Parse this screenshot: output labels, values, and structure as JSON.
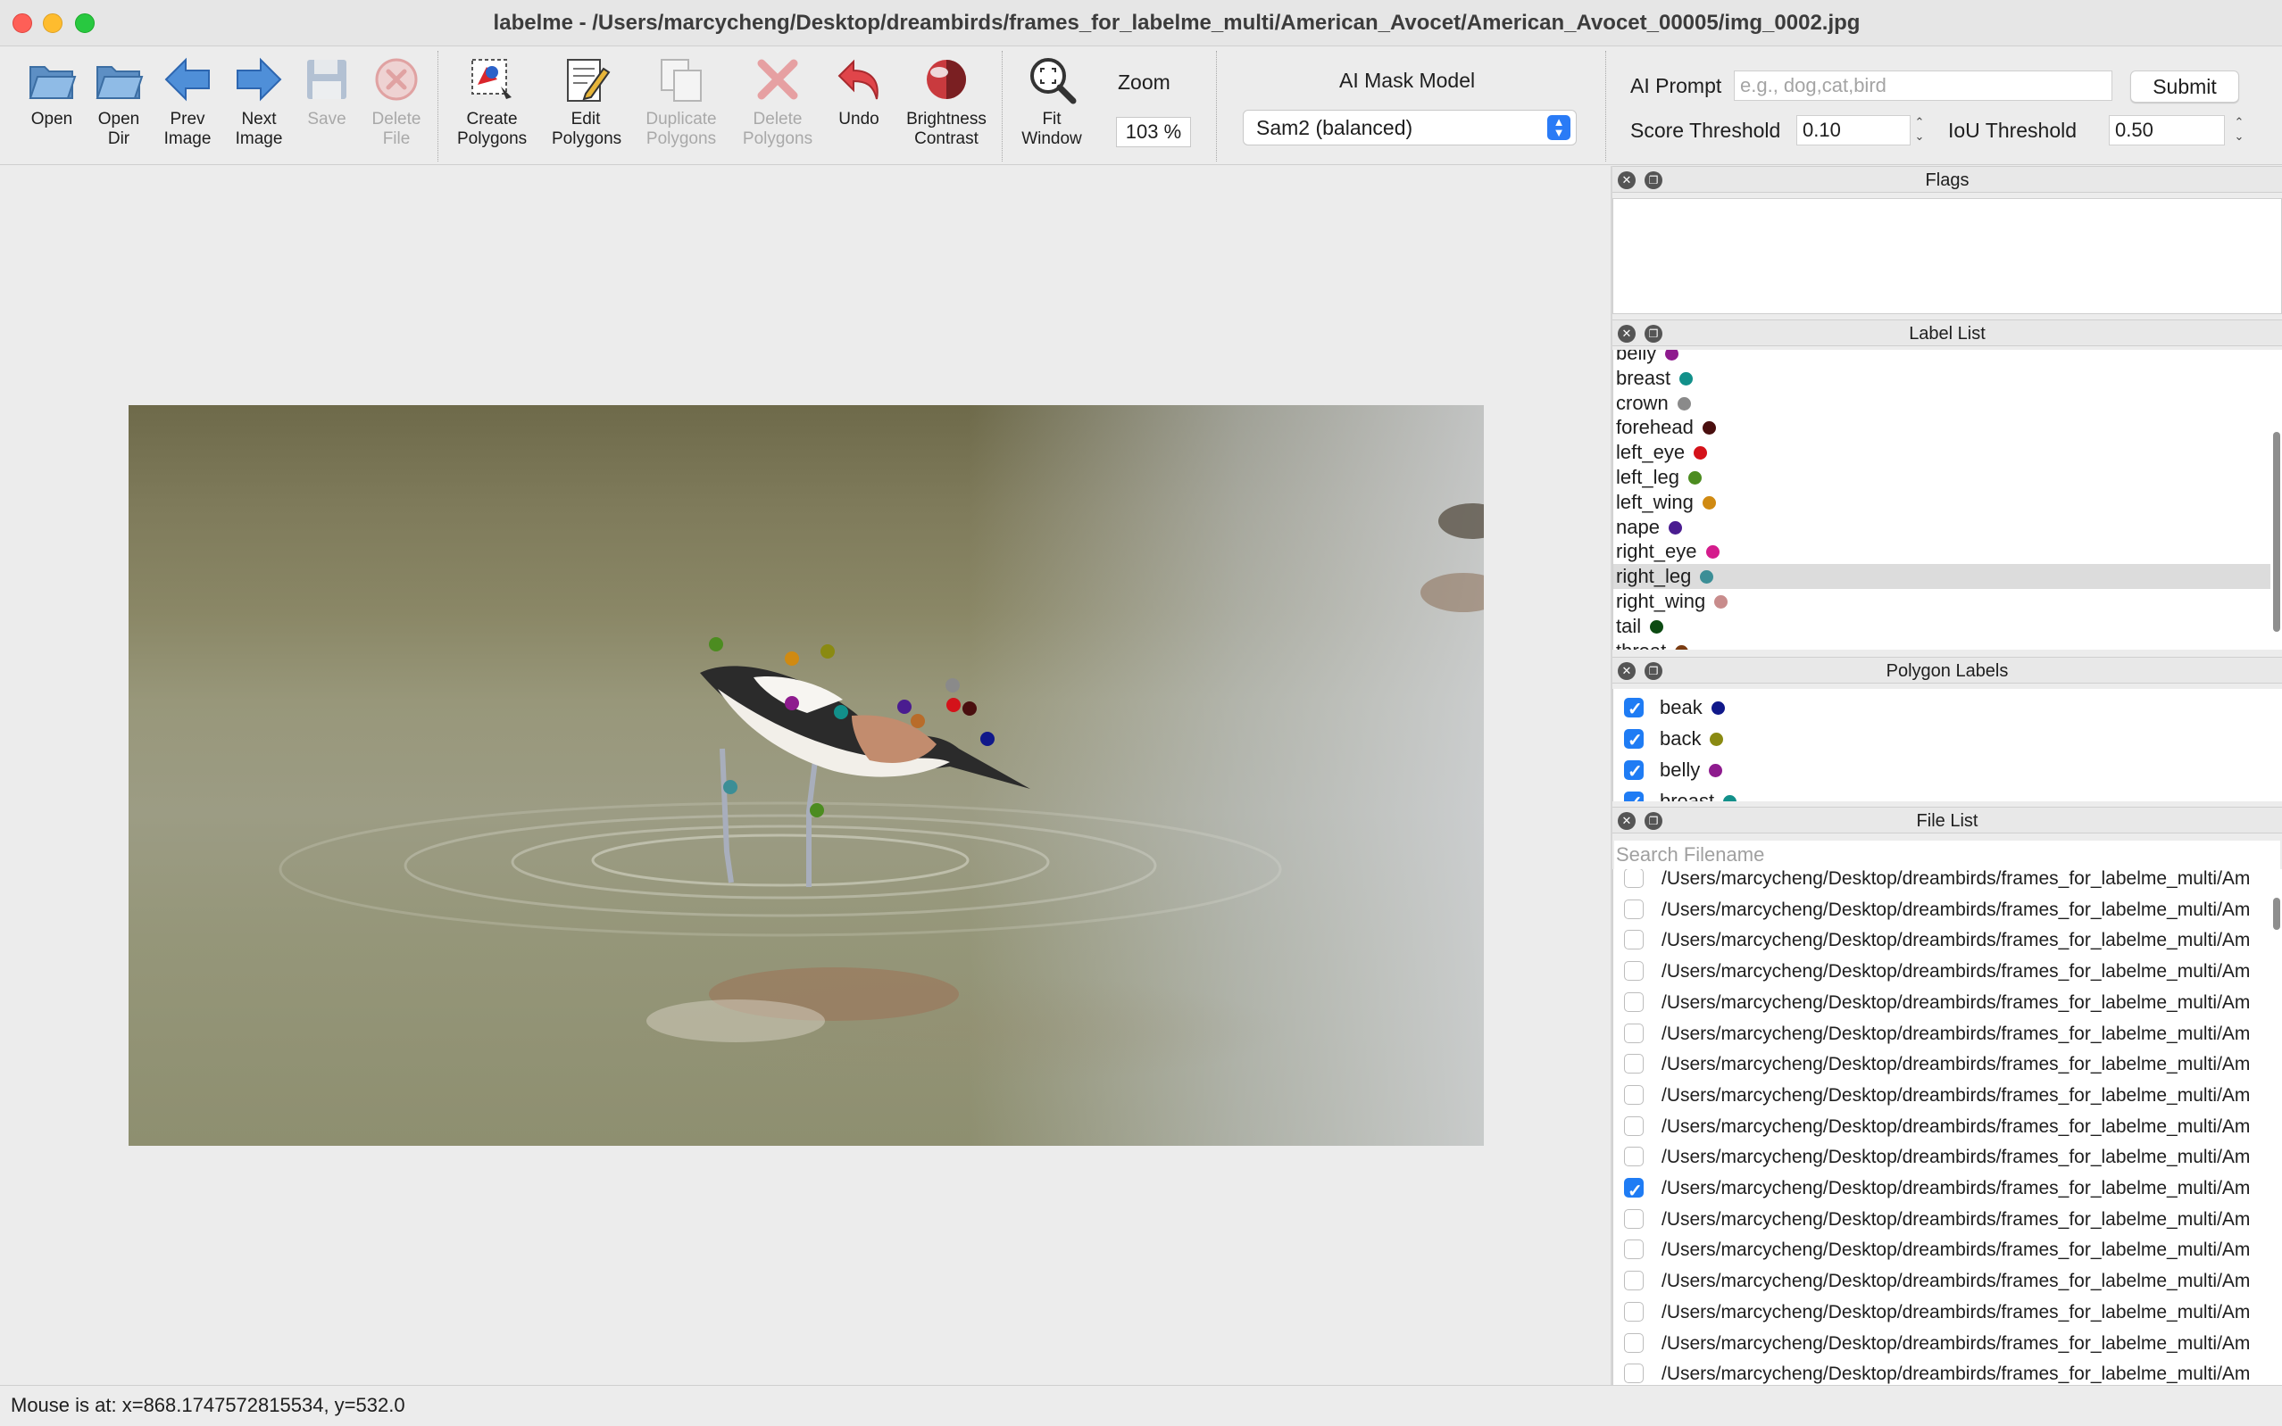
{
  "window": {
    "title": "labelme - /Users/marcycheng/Desktop/dreambirds/frames_for_labelme_multi/American_Avocet/American_Avocet_00005/img_0002.jpg"
  },
  "toolbar": {
    "open": "Open",
    "open_dir": [
      "Open",
      "Dir"
    ],
    "prev_image": [
      "Prev",
      "Image"
    ],
    "next_image": [
      "Next",
      "Image"
    ],
    "save": "Save",
    "delete_file": [
      "Delete",
      "File"
    ],
    "create_polygons": [
      "Create",
      "Polygons"
    ],
    "edit_polygons": [
      "Edit",
      "Polygons"
    ],
    "duplicate_polygons": [
      "Duplicate",
      "Polygons"
    ],
    "delete_polygons": [
      "Delete",
      "Polygons"
    ],
    "undo": "Undo",
    "brightness_contrast": [
      "Brightness",
      "Contrast"
    ],
    "fit_window": [
      "Fit",
      "Window"
    ],
    "zoom_label": "Zoom",
    "zoom_value": "103 %",
    "ai_mask_model_label": "AI Mask Model",
    "ai_mask_model_value": "Sam2 (balanced)",
    "ai_prompt_label": "AI Prompt",
    "ai_prompt_placeholder": "e.g., dog,cat,bird",
    "submit": "Submit",
    "score_threshold_label": "Score Threshold",
    "score_threshold_value": "0.10",
    "iou_threshold_label": "IoU Threshold",
    "iou_threshold_value": "0.50"
  },
  "docks": {
    "flags": "Flags",
    "label_list": "Label List",
    "polygon_labels": "Polygon Labels",
    "file_list": "File List"
  },
  "label_list": [
    {
      "label": "belly",
      "color": "#8e1b8e"
    },
    {
      "label": "breast",
      "color": "#12908a"
    },
    {
      "label": "crown",
      "color": "#8a8a8a"
    },
    {
      "label": "forehead",
      "color": "#4a0f0f"
    },
    {
      "label": "left_eye",
      "color": "#d4121a"
    },
    {
      "label": "left_leg",
      "color": "#4c8c20"
    },
    {
      "label": "left_wing",
      "color": "#d08a12"
    },
    {
      "label": "nape",
      "color": "#4a1c90"
    },
    {
      "label": "right_eye",
      "color": "#d41c8c"
    },
    {
      "label": "right_leg",
      "color": "#3c8e96",
      "selected": true
    },
    {
      "label": "right_wing",
      "color": "#c88c8c"
    },
    {
      "label": "tail",
      "color": "#0c4a12"
    },
    {
      "label": "throat",
      "color": "#7a3c12"
    }
  ],
  "polygon_labels": [
    {
      "label": "beak",
      "color": "#10188a",
      "checked": true
    },
    {
      "label": "back",
      "color": "#8a8a12",
      "checked": true
    },
    {
      "label": "belly",
      "color": "#8e1b8e",
      "checked": true
    },
    {
      "label": "breast",
      "color": "#12908a",
      "checked": true
    }
  ],
  "file_list": {
    "search_placeholder": "Search Filename",
    "items": [
      {
        "path": "/Users/marcycheng/Desktop/dreambirds/frames_for_labelme_multi/Am",
        "checked": false
      },
      {
        "path": "/Users/marcycheng/Desktop/dreambirds/frames_for_labelme_multi/Am",
        "checked": false
      },
      {
        "path": "/Users/marcycheng/Desktop/dreambirds/frames_for_labelme_multi/Am",
        "checked": false
      },
      {
        "path": "/Users/marcycheng/Desktop/dreambirds/frames_for_labelme_multi/Am",
        "checked": false
      },
      {
        "path": "/Users/marcycheng/Desktop/dreambirds/frames_for_labelme_multi/Am",
        "checked": false
      },
      {
        "path": "/Users/marcycheng/Desktop/dreambirds/frames_for_labelme_multi/Am",
        "checked": false
      },
      {
        "path": "/Users/marcycheng/Desktop/dreambirds/frames_for_labelme_multi/Am",
        "checked": false
      },
      {
        "path": "/Users/marcycheng/Desktop/dreambirds/frames_for_labelme_multi/Am",
        "checked": false
      },
      {
        "path": "/Users/marcycheng/Desktop/dreambirds/frames_for_labelme_multi/Am",
        "checked": false
      },
      {
        "path": "/Users/marcycheng/Desktop/dreambirds/frames_for_labelme_multi/Am",
        "checked": false
      },
      {
        "path": "/Users/marcycheng/Desktop/dreambirds/frames_for_labelme_multi/Am",
        "checked": true
      },
      {
        "path": "/Users/marcycheng/Desktop/dreambirds/frames_for_labelme_multi/Am",
        "checked": false
      },
      {
        "path": "/Users/marcycheng/Desktop/dreambirds/frames_for_labelme_multi/Am",
        "checked": false
      },
      {
        "path": "/Users/marcycheng/Desktop/dreambirds/frames_for_labelme_multi/Am",
        "checked": false
      },
      {
        "path": "/Users/marcycheng/Desktop/dreambirds/frames_for_labelme_multi/Am",
        "checked": false
      },
      {
        "path": "/Users/marcycheng/Desktop/dreambirds/frames_for_labelme_multi/Am",
        "checked": false
      },
      {
        "path": "/Users/marcycheng/Desktop/dreambirds/frames_for_labelme_multi/Am",
        "checked": false
      }
    ]
  },
  "status": {
    "mouse": "Mouse is at: x=868.1747572815534, y=532.0"
  }
}
